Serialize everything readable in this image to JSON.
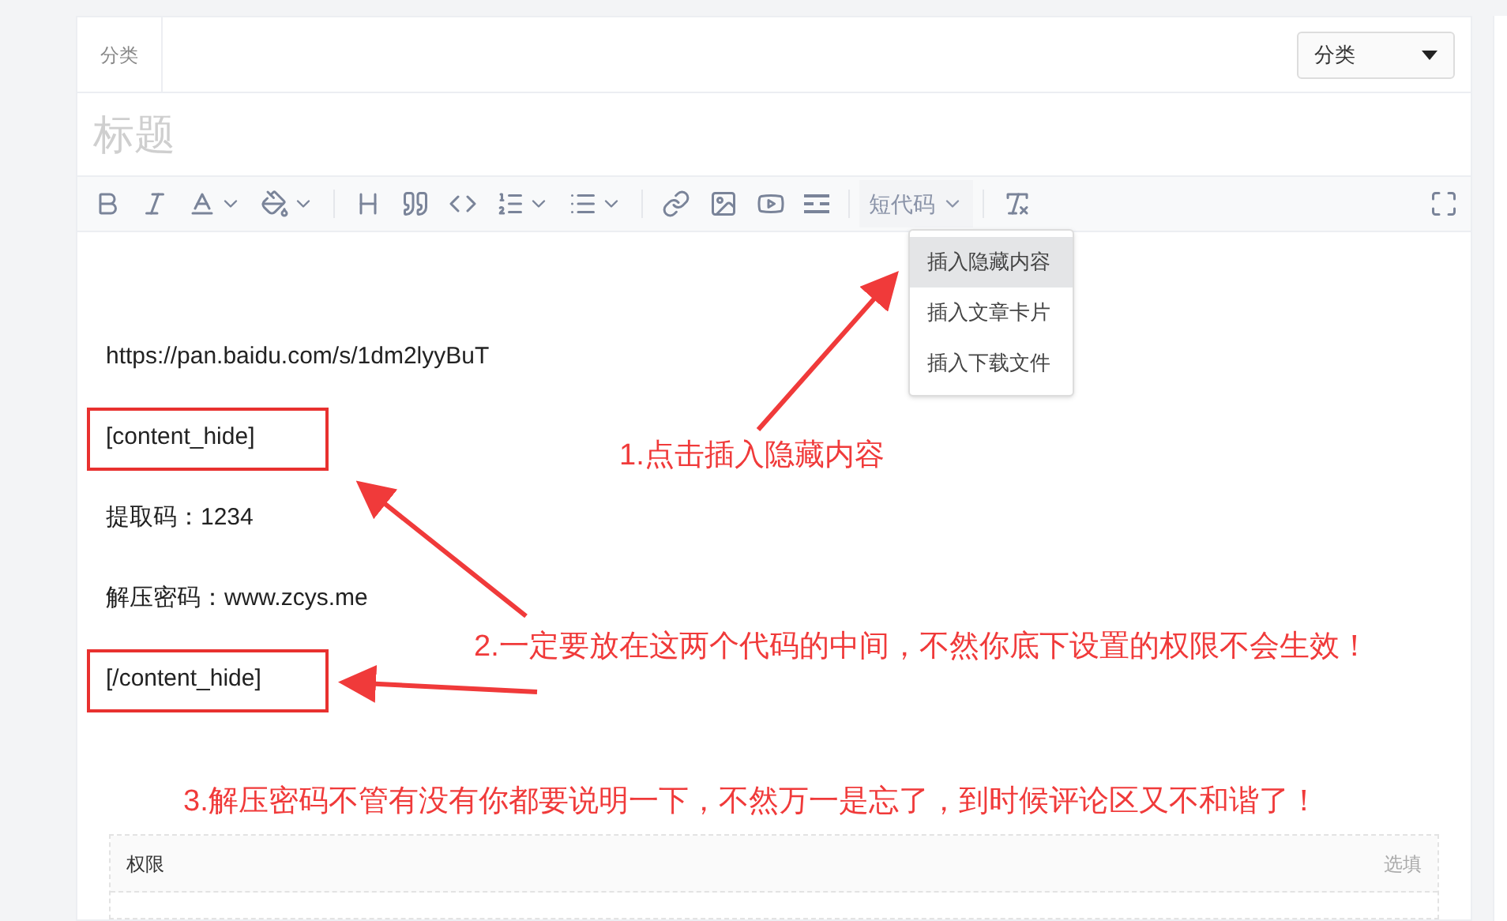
{
  "category": {
    "label": "分类",
    "select_value": "分类"
  },
  "title": {
    "placeholder": "标题"
  },
  "toolbar": [
    {
      "kind": "bold"
    },
    {
      "kind": "italic"
    },
    {
      "kind": "font-color",
      "dropdown": true
    },
    {
      "kind": "fill",
      "dropdown": true
    },
    {
      "kind": "sep"
    },
    {
      "kind": "heading"
    },
    {
      "kind": "quote"
    },
    {
      "kind": "code"
    },
    {
      "kind": "ordered-list",
      "dropdown": true
    },
    {
      "kind": "bullet-list",
      "dropdown": true
    },
    {
      "kind": "sep"
    },
    {
      "kind": "link"
    },
    {
      "kind": "image"
    },
    {
      "kind": "video"
    },
    {
      "kind": "divider"
    },
    {
      "kind": "sep"
    },
    {
      "kind": "shortcode",
      "label": "短代码",
      "dropdown": true
    },
    {
      "kind": "sep"
    },
    {
      "kind": "clear-format"
    }
  ],
  "shortcode_menu": [
    {
      "label": "插入隐藏内容",
      "selected": true
    },
    {
      "label": "插入文章卡片",
      "selected": false
    },
    {
      "label": "插入下载文件",
      "selected": false
    }
  ],
  "content": [
    {
      "text": "https://pan.baidu.com/s/1dm2lyyBuT",
      "highlighted": false
    },
    {
      "text": "[content_hide]",
      "highlighted": true
    },
    {
      "text": "提取码：1234",
      "highlighted": false
    },
    {
      "text": "解压密码：www.zcys.me",
      "highlighted": false
    },
    {
      "text": "[/content_hide]",
      "highlighted": true
    }
  ],
  "annotations": [
    "1.点击插入隐藏内容",
    "2.一定要放在这两个代码的中间，不然你底下设置的权限不会生效！",
    "3.解压密码不管有没有你都要说明一下，不然万一是忘了，到时候评论区又不和谐了！"
  ],
  "permission": {
    "label": "权限",
    "hint": "选填"
  }
}
